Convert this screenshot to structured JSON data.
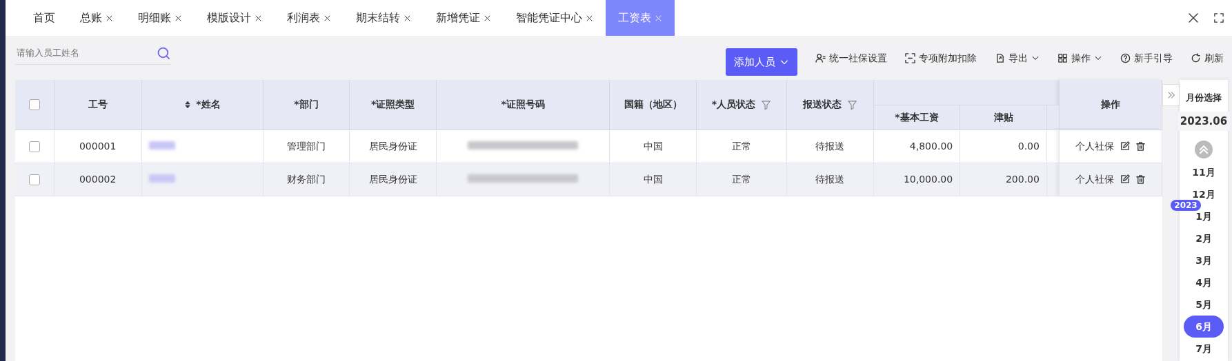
{
  "tabs": [
    {
      "label": "首页",
      "closable": false,
      "selected": false
    },
    {
      "label": "总账",
      "closable": true,
      "selected": false
    },
    {
      "label": "明细账",
      "closable": true,
      "selected": false
    },
    {
      "label": "模版设计",
      "closable": true,
      "selected": false
    },
    {
      "label": "利润表",
      "closable": true,
      "selected": false
    },
    {
      "label": "期末结转",
      "closable": true,
      "selected": false
    },
    {
      "label": "新增凭证",
      "closable": true,
      "selected": false
    },
    {
      "label": "智能凭证中心",
      "closable": true,
      "selected": false
    },
    {
      "label": "工资表",
      "closable": true,
      "selected": true
    }
  ],
  "search": {
    "placeholder": "请输入员工姓名"
  },
  "add_button": {
    "label": "添加人员"
  },
  "toolbar": [
    {
      "label": "统一社保设置",
      "kind": "person",
      "dropdown": false
    },
    {
      "label": "专项附加扣除",
      "kind": "scan",
      "dropdown": false
    },
    {
      "label": "导出",
      "kind": "export",
      "dropdown": true
    },
    {
      "label": "操作",
      "kind": "grid",
      "dropdown": true
    },
    {
      "label": "新手引导",
      "kind": "help",
      "dropdown": false
    },
    {
      "label": "刷新",
      "kind": "refresh",
      "dropdown": false
    }
  ],
  "table": {
    "select_all": {
      "checked": false
    },
    "columns": [
      {
        "label": "工号",
        "kind": "plain"
      },
      {
        "label": "*姓名",
        "kind": "sort"
      },
      {
        "label": "*部门",
        "kind": "plain"
      },
      {
        "label": "*证照类型",
        "kind": "plain"
      },
      {
        "label": "*证照号码",
        "kind": "plain"
      },
      {
        "label": "国籍（地区）",
        "kind": "plain"
      },
      {
        "label": "*人员状态",
        "kind": "filter"
      },
      {
        "label": "报送状态",
        "kind": "filter"
      },
      {
        "label": "*基本工资",
        "kind": "sub"
      },
      {
        "label": "津贴",
        "kind": "sub"
      },
      {
        "label": "操作",
        "kind": "fixed"
      }
    ],
    "rows": [
      {
        "checked": false,
        "hovered": false,
        "cells": [
          "000001",
          "",
          "管理部门",
          "居民身份证",
          "",
          "中国",
          "正常",
          "待报送",
          "4,800.00",
          "0.00",
          "个人社保"
        ]
      },
      {
        "checked": false,
        "hovered": true,
        "cells": [
          "000002",
          "",
          "财务部门",
          "居民身份证",
          "",
          "中国",
          "正常",
          "待报送",
          "10,000.00",
          "200.00",
          "个人社保"
        ]
      }
    ]
  },
  "month_panel": {
    "title": "月份选择",
    "current": "2023.06",
    "items": [
      {
        "kind": "month",
        "label": "11月",
        "selected": false
      },
      {
        "kind": "month",
        "label": "12月",
        "selected": false
      },
      {
        "kind": "year",
        "label": "2023"
      },
      {
        "kind": "month",
        "label": "1月",
        "selected": false
      },
      {
        "kind": "month",
        "label": "2月",
        "selected": false
      },
      {
        "kind": "month",
        "label": "3月",
        "selected": false
      },
      {
        "kind": "month",
        "label": "4月",
        "selected": false
      },
      {
        "kind": "month",
        "label": "5月",
        "selected": false
      },
      {
        "kind": "month",
        "label": "6月",
        "selected": true
      },
      {
        "kind": "month",
        "label": "7月",
        "selected": false
      }
    ]
  }
}
